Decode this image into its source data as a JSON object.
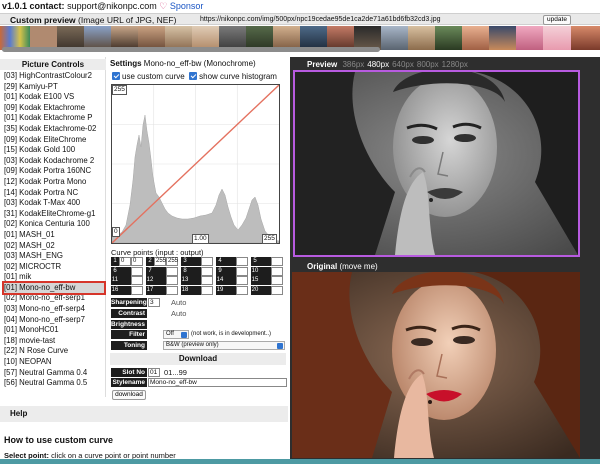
{
  "header": {
    "version": "v1.0.1",
    "contact_label": "contact:",
    "contact_email": "support@nikonpc.com",
    "sponsor_label": "Sponsor"
  },
  "custom_preview": {
    "title": "Custom preview",
    "subtitle": "(Image URL of JPG, NEF)",
    "url": "https://nikonpc.com/img/500px/npc19cedae95de1ca2de71a61bd6fb32cd3.jpg",
    "update_label": "update"
  },
  "picture_controls": {
    "header": "Picture Controls",
    "items": [
      "[03] HighContrastColour2",
      "[29] Kamiyu-PT",
      "[01] Kodak E100 VS",
      "[09] Kodak Ektachrome",
      "[01] Kodak Ektachrome P",
      "[35] Kodak Ektachrome-02",
      "[09] Kodak EliteChrome",
      "[15] Kodak Gold 100",
      "[03] Kodak Kodachrome 2",
      "[09] Kodak Portra 160NC",
      "[12] Kodak Portra Mono",
      "[14] Kodak Portra NC",
      "[03] Kodak T-Max 400",
      "[31] KodakEliteChrome-g1",
      "[02] Konica Centuria 100",
      "[01] MASH_01",
      "[02] MASH_02",
      "[03] MASH_ENG",
      "[02] MICROCTR",
      "[01] mik",
      "[01] Mono-no_eff-bw",
      "[02] Mono-no_eff-serp1",
      "[03] Mono-no_eff-serp4",
      "[04] Mono-no_eff-serp7",
      "[01] MonoHC01",
      "[18] movie-tast",
      "[22] N Rose Curve",
      "[10] NEOPAN",
      "[57] Neutral Gamma 0.4",
      "[56] Neutral Gamma 0.5"
    ],
    "selected_index": 20
  },
  "settings": {
    "title": "Settings",
    "name": "Mono-no_eff-bw (Monochrome)",
    "use_custom_curve": "use custom curve",
    "show_histogram": "show curve histogram",
    "curve_ticks": {
      "top_left": "255",
      "bottom_left": "0",
      "mid": "1.00",
      "bottom_right": "255"
    },
    "curve_points_label": "Curve points (input : output)",
    "curve_points": [
      {
        "n": "1",
        "in": "0",
        "out": "0"
      },
      {
        "n": "2",
        "in": "255",
        "out": "255"
      },
      {
        "n": "3",
        "in": "",
        "out": ""
      },
      {
        "n": "4",
        "in": "",
        "out": ""
      },
      {
        "n": "5",
        "in": "",
        "out": ""
      },
      {
        "n": "6",
        "in": "",
        "out": ""
      },
      {
        "n": "7",
        "in": "",
        "out": ""
      },
      {
        "n": "8",
        "in": "",
        "out": ""
      },
      {
        "n": "9",
        "in": "",
        "out": ""
      },
      {
        "n": "10",
        "in": "",
        "out": ""
      },
      {
        "n": "11",
        "in": "",
        "out": ""
      },
      {
        "n": "12",
        "in": "",
        "out": ""
      },
      {
        "n": "13",
        "in": "",
        "out": ""
      },
      {
        "n": "14",
        "in": "",
        "out": ""
      },
      {
        "n": "15",
        "in": "",
        "out": ""
      },
      {
        "n": "16",
        "in": "",
        "out": ""
      },
      {
        "n": "17",
        "in": "",
        "out": ""
      },
      {
        "n": "18",
        "in": "",
        "out": ""
      },
      {
        "n": "19",
        "in": "",
        "out": ""
      },
      {
        "n": "20",
        "in": "",
        "out": ""
      }
    ],
    "sharpening": {
      "label": "Sharpening",
      "value": "3",
      "auto": "Auto"
    },
    "contrast": {
      "label": "Contrast",
      "auto": "Auto"
    },
    "brightness": {
      "label": "Brightness"
    },
    "filter": {
      "label": "Filter",
      "value": "Off",
      "note": "(not work, is in development..)"
    },
    "toning": {
      "label": "Toning",
      "value": "B&W (preview only)"
    }
  },
  "download": {
    "header": "Download",
    "slot_label": "Slot No",
    "slot_value": "01",
    "slot_range": "01...99",
    "stylename_label": "Stylename",
    "stylename_value": "Mono-no_eff-bw",
    "button": "download"
  },
  "help": {
    "header": "Help",
    "title": "How to use custom curve",
    "select_point_label": "Select point:",
    "select_point_text": "click on a curve point or point number"
  },
  "preview": {
    "title": "Preview",
    "sizes": [
      "386px",
      "480px",
      "640px",
      "800px",
      "1280px"
    ],
    "active_size_index": 1,
    "original_title": "Original",
    "original_hint": "(move me)"
  },
  "colors": {
    "accent_purple": "#b85be0",
    "selection_red": "#d6352a",
    "checkbox_blue": "#2f74d0",
    "curve_red": "#e4715f",
    "panel_dark": "#2e2e2e"
  }
}
